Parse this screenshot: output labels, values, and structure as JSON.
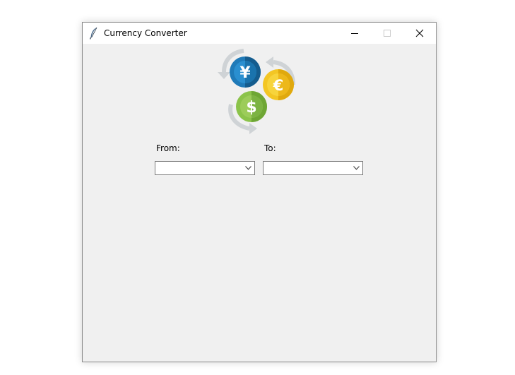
{
  "window": {
    "title": "Currency Converter",
    "app_icon": "feather-icon",
    "controls": {
      "minimize_icon": "minimize-icon",
      "maximize_icon": "maximize-icon",
      "close_icon": "close-icon"
    }
  },
  "logo": {
    "icon": "currency-exchange-logo",
    "symbols": {
      "yen": "¥",
      "euro": "€",
      "dollar": "$"
    },
    "colors": {
      "yen": "#1f7ab8",
      "euro": "#f3c624",
      "dollar": "#8bc34a",
      "arrows": "#cfd3d6"
    }
  },
  "form": {
    "from_label": "From:",
    "to_label": "To:",
    "from_value": "",
    "to_value": ""
  }
}
